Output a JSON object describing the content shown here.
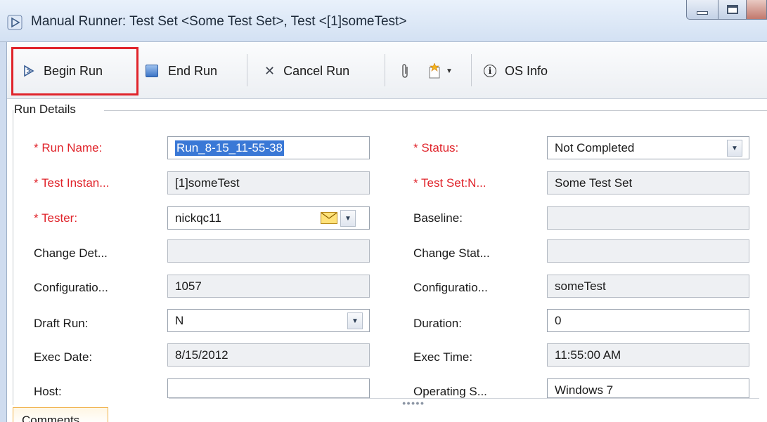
{
  "window": {
    "title": "Manual Runner: Test Set <Some Test Set>, Test <[1]someTest>"
  },
  "toolbar": {
    "begin_run": "Begin Run",
    "end_run": "End Run",
    "cancel_run": "Cancel Run",
    "os_info": "OS Info"
  },
  "section": {
    "title": "Run Details"
  },
  "fields": {
    "run_name": {
      "label": "* Run Name:",
      "value": "Run_8-15_11-55-38"
    },
    "status": {
      "label": "* Status:",
      "value": "Not Completed"
    },
    "test_instance": {
      "label": "* Test Instan...",
      "value": "[1]someTest"
    },
    "test_set": {
      "label": "* Test Set:N...",
      "value": "Some Test Set"
    },
    "tester": {
      "label": "* Tester:",
      "value": "nickqc11"
    },
    "baseline": {
      "label": "Baseline:",
      "value": ""
    },
    "change_det": {
      "label": "Change Det...",
      "value": ""
    },
    "change_stat": {
      "label": "Change Stat...",
      "value": ""
    },
    "configuration_id": {
      "label": "Configuratio...",
      "value": "1057"
    },
    "configuration_name": {
      "label": "Configuratio...",
      "value": "someTest"
    },
    "draft_run": {
      "label": "Draft Run:",
      "value": "N"
    },
    "duration": {
      "label": "Duration:",
      "value": "0"
    },
    "exec_date": {
      "label": "Exec Date:",
      "value": "8/15/2012"
    },
    "exec_time": {
      "label": "Exec Time:",
      "value": "11:55:00 AM"
    },
    "host": {
      "label": "Host:",
      "value": ""
    },
    "operating_system": {
      "label": "Operating S...",
      "value": "Windows 7"
    }
  },
  "tabs": {
    "comments": "Comments"
  },
  "colors": {
    "required_label": "#e0242b",
    "highlight": "#e0242b",
    "selection": "#3a78d6"
  }
}
